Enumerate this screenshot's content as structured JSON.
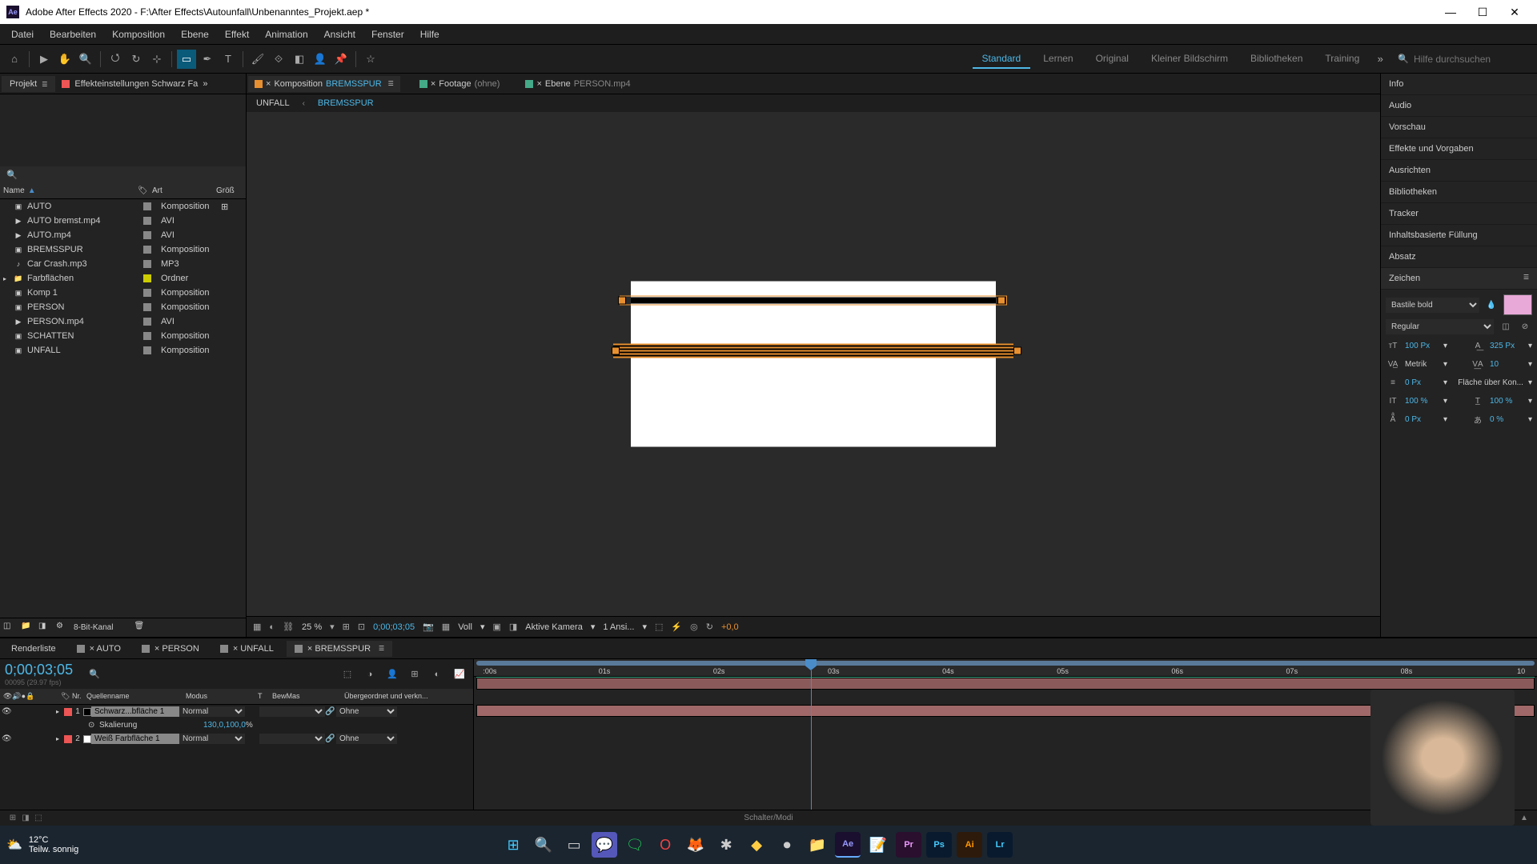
{
  "title": "Adobe After Effects 2020 - F:\\After Effects\\Autounfall\\Unbenanntes_Projekt.aep *",
  "menu": [
    "Datei",
    "Bearbeiten",
    "Komposition",
    "Ebene",
    "Effekt",
    "Animation",
    "Ansicht",
    "Fenster",
    "Hilfe"
  ],
  "workspaces": [
    "Standard",
    "Lernen",
    "Original",
    "Kleiner Bildschirm",
    "Bibliotheken",
    "Training"
  ],
  "activeWorkspace": "Standard",
  "searchHelp": "Hilfe durchsuchen",
  "projectTab": "Projekt",
  "effectStrip": "Effekteinstellungen Schwarz Fa",
  "projCols": {
    "name": "Name",
    "art": "Art",
    "size": "Größ"
  },
  "projectItems": [
    {
      "name": "AUTO",
      "icon": "comp",
      "art": "Komposition",
      "color": "#888",
      "used": true
    },
    {
      "name": "AUTO bremst.mp4",
      "icon": "vid",
      "art": "AVI",
      "color": "#888"
    },
    {
      "name": "AUTO.mp4",
      "icon": "vid",
      "art": "AVI",
      "color": "#888"
    },
    {
      "name": "BREMSSPUR",
      "icon": "comp",
      "art": "Komposition",
      "color": "#888"
    },
    {
      "name": "Car Crash.mp3",
      "icon": "aud",
      "art": "MP3",
      "color": "#888"
    },
    {
      "name": "Farbflächen",
      "icon": "folder",
      "art": "Ordner",
      "color": "#cc0",
      "exp": true
    },
    {
      "name": "Komp 1",
      "icon": "comp",
      "art": "Komposition",
      "color": "#888"
    },
    {
      "name": "PERSON",
      "icon": "comp",
      "art": "Komposition",
      "color": "#888"
    },
    {
      "name": "PERSON.mp4",
      "icon": "vid",
      "art": "AVI",
      "color": "#888"
    },
    {
      "name": "SCHATTEN",
      "icon": "comp",
      "art": "Komposition",
      "color": "#888"
    },
    {
      "name": "UNFALL",
      "icon": "comp",
      "art": "Komposition",
      "color": "#888"
    }
  ],
  "projFooter": "8-Bit-Kanal",
  "compTabs": [
    {
      "label": "Komposition",
      "highlight": "BREMSSPUR",
      "active": true
    },
    {
      "label": "Footage",
      "extra": "(ohne)"
    },
    {
      "label": "Ebene",
      "extra": "PERSON.mp4"
    }
  ],
  "navTabs": [
    {
      "label": "UNFALL"
    },
    {
      "label": "BREMSSPUR",
      "active": true
    }
  ],
  "vpFooter": {
    "zoom": "25 %",
    "res": "Voll",
    "time": "0;00;03;05",
    "cam": "Aktive Kamera",
    "views": "1 Ansi...",
    "exp": "+0,0"
  },
  "rightPanels": [
    "Info",
    "Audio",
    "Vorschau",
    "Effekte und Vorgaben",
    "Ausrichten",
    "Bibliotheken",
    "Tracker",
    "Inhaltsbasierte Füllung",
    "Absatz",
    "Zeichen"
  ],
  "char": {
    "font": "Bastile bold",
    "style": "Regular",
    "size": "100",
    "leading": "325",
    "kerning": "Metrik",
    "tracking": "10",
    "stroke": "0",
    "strokeUnit": "Px",
    "fill": "Fläche über Kon...",
    "vscale": "100",
    "hscale": "100",
    "baseline": "0",
    "tsume": "0"
  },
  "tlTabs": [
    {
      "label": "Renderliste"
    },
    {
      "label": "AUTO"
    },
    {
      "label": "PERSON"
    },
    {
      "label": "UNFALL"
    },
    {
      "label": "BREMSSPUR",
      "active": true
    }
  ],
  "timecode": "0;00;03;05",
  "frames": "00095 (29.97 fps)",
  "tlHeaders": {
    "nr": "Nr.",
    "src": "Quellenname",
    "mode": "Modus",
    "t": "T",
    "bm": "BewMas",
    "parent": "Übergeordnet und verkn..."
  },
  "layers": [
    {
      "num": "1",
      "name": "Schwarz...bfläche 1",
      "mode": "Normal",
      "parent": "Ohne",
      "color": "#e55",
      "icolor": "#000"
    },
    {
      "num": "2",
      "name": "Weiß Farbfläche 1",
      "mode": "Normal",
      "parent": "Ohne",
      "color": "#e55",
      "icolor": "#fff"
    }
  ],
  "prop": {
    "name": "Skalierung",
    "val": "130,0,100,0",
    "unit": "%"
  },
  "ticks": [
    ":00s",
    "01s",
    "02s",
    "03s",
    "04s",
    "05s",
    "06s",
    "07s",
    "08s",
    "10"
  ],
  "playheadPct": 31.7,
  "tlFooterMode": "Schalter/Modi",
  "weather": {
    "temp": "12°C",
    "desc": "Teilw. sonnig"
  }
}
